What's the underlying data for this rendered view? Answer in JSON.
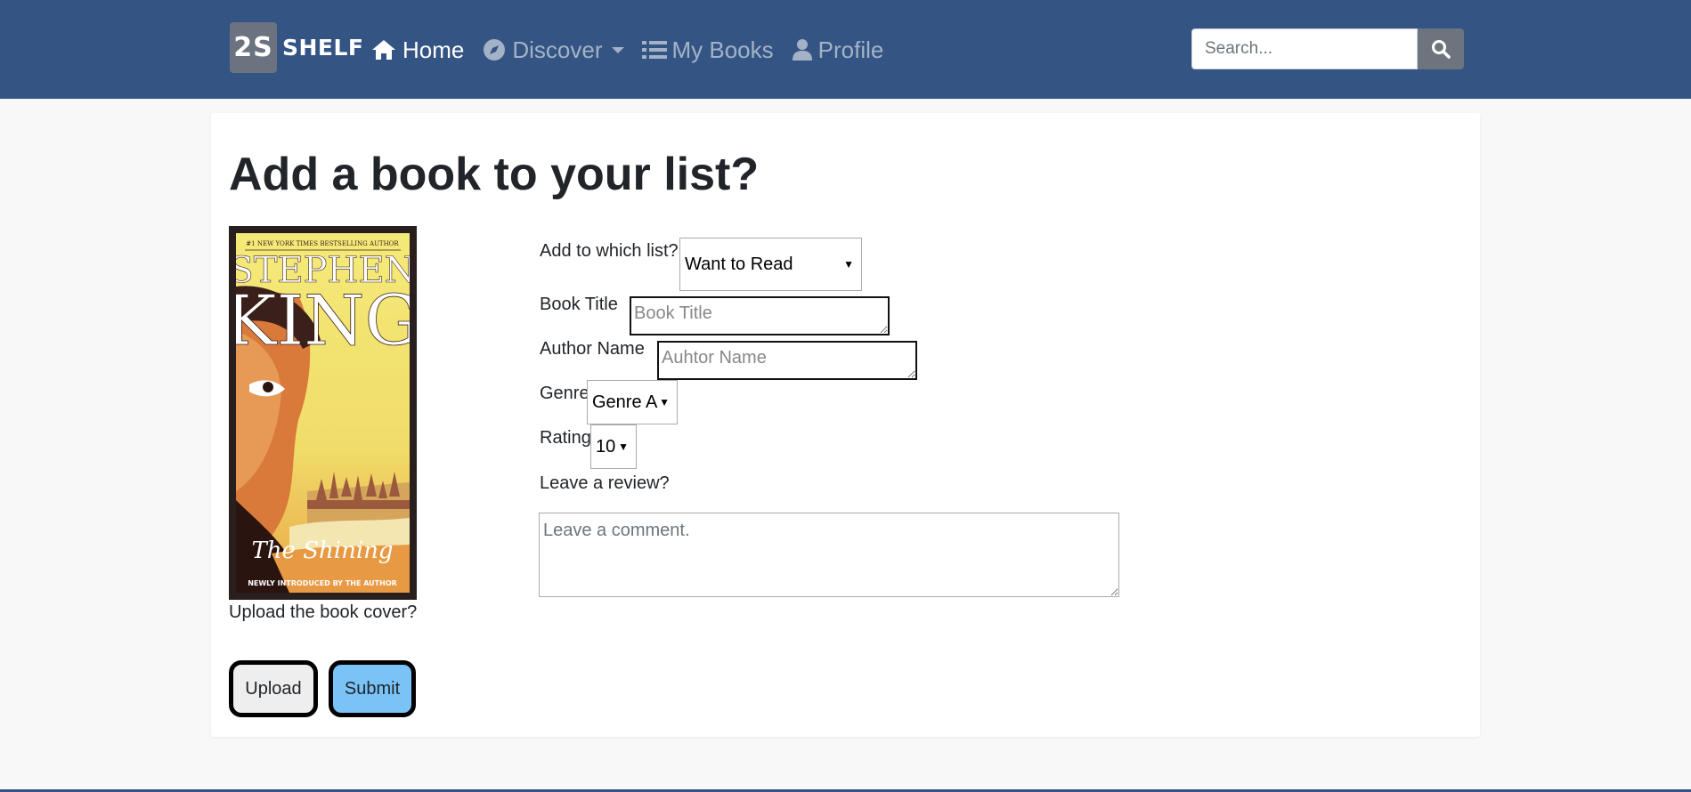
{
  "brand": {
    "mark": "2S",
    "name": "SHELF"
  },
  "nav": {
    "home": "Home",
    "discover": "Discover",
    "my_books": "My Books",
    "profile": "Profile"
  },
  "search": {
    "placeholder": "Search..."
  },
  "page": {
    "title": "Add a book to your list?",
    "cover_alt": "The Shining by Stephen King book cover",
    "cover_art_text": {
      "top": "#1 NEW YORK TIMES BESTSELLING AUTHOR",
      "author_first": "STEPHEN",
      "author_last": "KING",
      "title": "The Shining",
      "bottom": "NEWLY INTRODUCED BY THE AUTHOR"
    },
    "upload_label": "Upload the book cover?",
    "upload_button": "Upload",
    "submit_button": "Submit"
  },
  "form": {
    "list_label": "Add to which list?",
    "list_value": "Want to Read",
    "title_label": "Book Title",
    "title_placeholder": "Book Title",
    "author_label": "Author Name",
    "author_placeholder": "Auhtor Name",
    "genre_label": "Genre",
    "genre_value": "Genre A",
    "rating_label": "Rating",
    "rating_value": "10",
    "review_label": "Leave a review?",
    "review_placeholder": "Leave a comment."
  },
  "colors": {
    "navbar": "#345483",
    "submit": "#79c3f7",
    "upload": "#eeeeee"
  }
}
